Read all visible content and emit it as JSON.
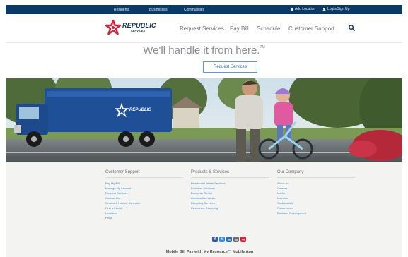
{
  "topbar": {
    "residents": "Residents",
    "businesses": "Businesses",
    "communities": "Communities",
    "add_location": "Add Location",
    "login": "Login/Sign Up"
  },
  "header": {
    "logo_line1": "REPUBLIC",
    "logo_line2": "SERVICES",
    "nav": [
      "Request Services",
      "Pay Bill",
      "Schedule",
      "Customer Support"
    ],
    "search_icon": "search-icon"
  },
  "hero": {
    "tagline": "We'll handle it from here.",
    "tagline_mark": "TM",
    "cta_label": "Request Services",
    "truck_logo_text": "REPUBLIC"
  },
  "footer": {
    "columns": [
      {
        "title": "Customer Support",
        "links": [
          "Pay My Bill",
          "Manage My Account",
          "Request Services",
          "Contact Us",
          "Service & Holiday Schedule",
          "Find a Facility",
          "Locations",
          "FAQs"
        ]
      },
      {
        "title": "Products & Services",
        "links": [
          "Residential Waste Services",
          "Business Solutions",
          "Dumpster Rental",
          "Construction Waste",
          "Recycling Services",
          "Electronics Recycling"
        ]
      },
      {
        "title": "Our Company",
        "links": [
          "About Us",
          "Careers",
          "Media",
          "Investors",
          "Sustainability",
          "Procurement",
          "Business Development"
        ]
      }
    ],
    "social": [
      "f",
      "t",
      "in",
      "ig",
      "yt"
    ],
    "promo": "Mobile Bill Pay with My Resource™ Mobile App"
  },
  "colors": {
    "topbar": "#0b3a66",
    "brand_navy": "#12335f",
    "brand_red": "#d0263a",
    "link_blue": "#4a84b9",
    "cta_border": "#4aa0d8"
  }
}
